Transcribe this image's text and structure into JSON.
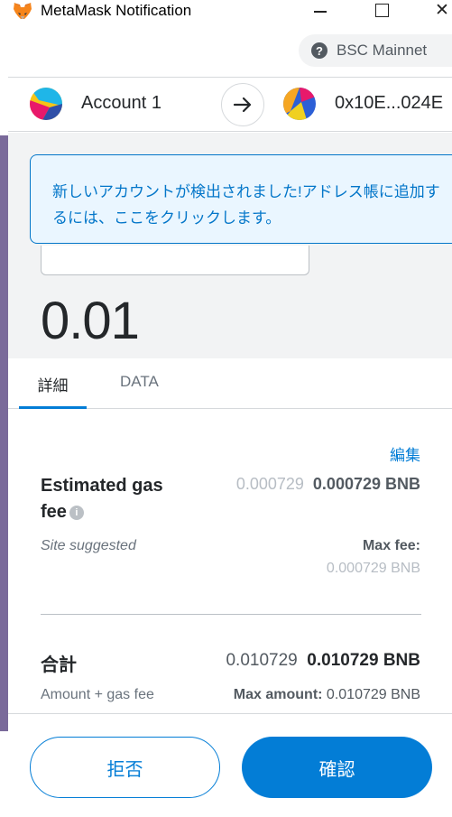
{
  "window": {
    "title": "MetaMask Notification"
  },
  "network": {
    "label": "BSC Mainnet",
    "icon": "question-icon"
  },
  "accounts": {
    "from": "Account 1",
    "to": "0x10E...024E"
  },
  "notice": {
    "text": "新しいアカウントが検出されました!アドレス帳に追加するには、ここをクリックします。"
  },
  "transaction": {
    "amount": "0.01"
  },
  "tabs": [
    {
      "label": "詳細",
      "active": true
    },
    {
      "label": "DATA",
      "active": false
    }
  ],
  "details": {
    "edit_label": "編集",
    "gas_title": "Estimated gas fee",
    "gas_value_muted": "0.000729",
    "gas_value_bold": "0.000729 BNB",
    "site_suggested": "Site suggested",
    "max_fee_label": "Max fee:",
    "max_fee_value": "0.000729 BNB",
    "total_label": "合計",
    "total_value": "0.010729",
    "total_value_bold": "0.010729 BNB",
    "amount_gas_label": "Amount + gas fee",
    "max_amount_label": "Max amount:",
    "max_amount_value": "0.010729 BNB"
  },
  "footer": {
    "reject_label": "拒否",
    "confirm_label": "確認"
  },
  "colors": {
    "accent": "#037dd6",
    "notice_bg": "#eaf6ff",
    "muted": "#b7bdc4"
  }
}
